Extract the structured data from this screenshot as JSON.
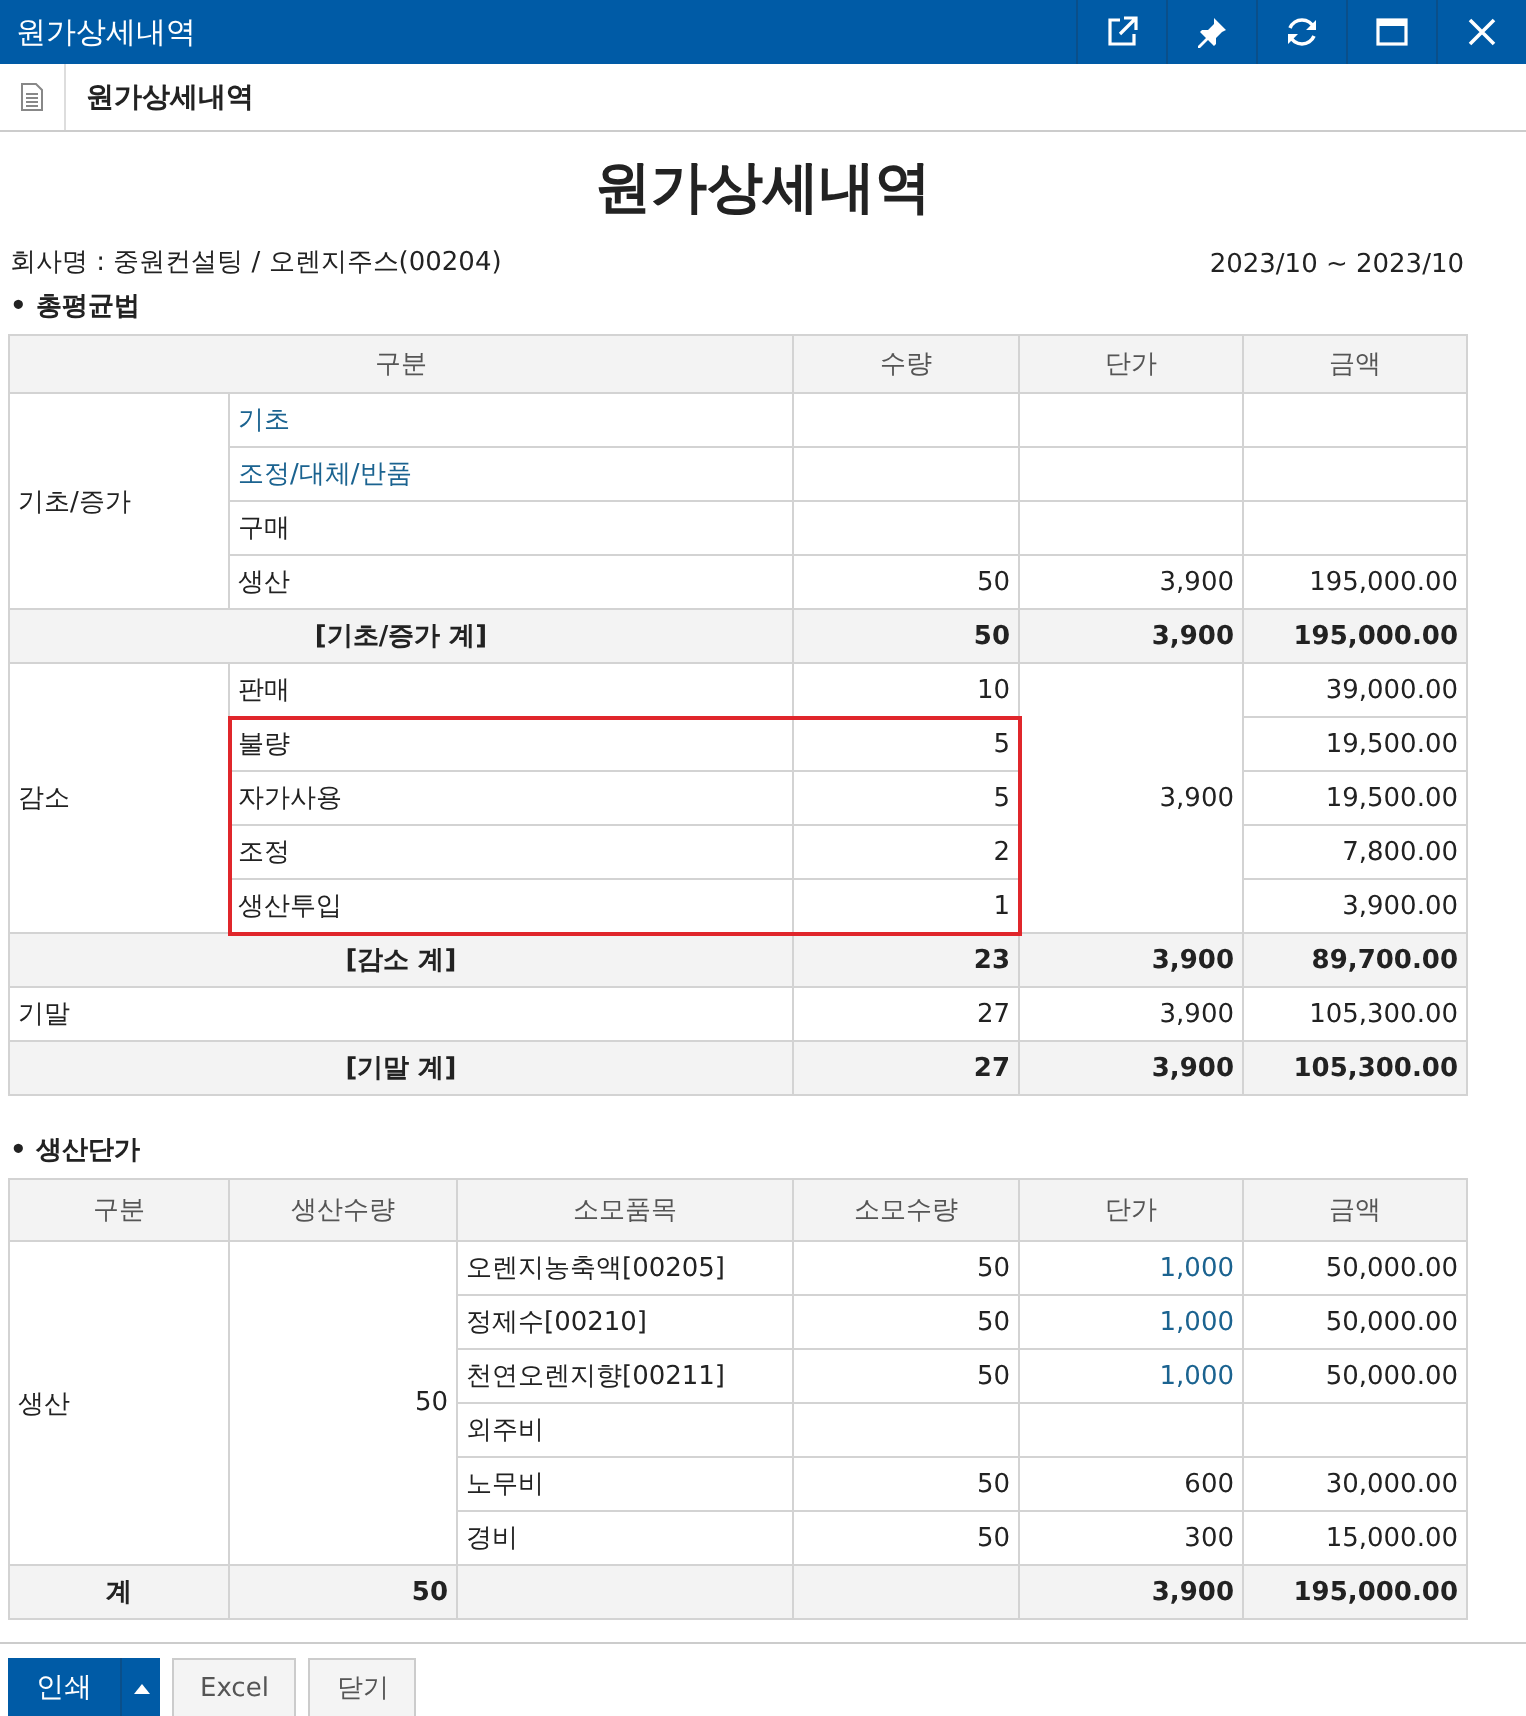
{
  "window": {
    "title": "원가상세내역"
  },
  "tab": {
    "title": "원가상세내역"
  },
  "report": {
    "title": "원가상세내역",
    "company": "회사명 : 중원컨설팅 / 오렌지주스(00204)",
    "period": "2023/10 ~ 2023/10"
  },
  "average_method": {
    "title": "• 총평균법",
    "columns": [
      "구분",
      "수량",
      "단가",
      "금액"
    ],
    "groups": [
      {
        "kind": "nested",
        "label": "기초/증가",
        "rows": [
          {
            "label": "기초",
            "link": true,
            "highlighted": false
          },
          {
            "label": "조정/대체/반품",
            "link": true,
            "highlighted": false
          },
          {
            "label": "구매",
            "link": false,
            "highlighted": false
          },
          {
            "label": "생산",
            "link": false,
            "highlighted": false,
            "qty": "50",
            "price": "3,900",
            "amount": "195,000.00"
          }
        ],
        "subtotal": {
          "label": "[기초/증가 계]",
          "qty": "50",
          "price": "3,900",
          "amount": "195,000.00"
        }
      },
      {
        "kind": "nested",
        "label": "감소",
        "shared_price": "3,900",
        "rows": [
          {
            "label": "판매",
            "link": false,
            "highlighted": false,
            "qty": "10",
            "amount": "39,000.00"
          },
          {
            "label": "불량",
            "link": false,
            "highlighted": true,
            "qty": "5",
            "amount": "19,500.00"
          },
          {
            "label": "자가사용",
            "link": false,
            "highlighted": true,
            "qty": "5",
            "amount": "19,500.00"
          },
          {
            "label": "조정",
            "link": false,
            "highlighted": true,
            "qty": "2",
            "amount": "7,800.00"
          },
          {
            "label": "생산투입",
            "link": false,
            "highlighted": true,
            "qty": "1",
            "amount": "3,900.00"
          }
        ],
        "subtotal": {
          "label": "[감소 계]",
          "qty": "23",
          "price": "3,900",
          "amount": "89,700.00"
        }
      },
      {
        "kind": "flat",
        "label": "기말",
        "qty": "27",
        "price": "3,900",
        "amount": "105,300.00",
        "subtotal": {
          "label": "[기말 계]",
          "qty": "27",
          "price": "3,900",
          "amount": "105,300.00"
        }
      }
    ]
  },
  "production_cost": {
    "title": "• 생산단가",
    "columns": [
      "구분",
      "생산수량",
      "소모품목",
      "소모수량",
      "단가",
      "금액"
    ],
    "group": {
      "label": "생산",
      "qty": "50",
      "items": [
        {
          "name": "오렌지농축액[00205]",
          "qty": "50",
          "price": "1,000",
          "price_link": true,
          "amount": "50,000.00"
        },
        {
          "name": "정제수[00210]",
          "qty": "50",
          "price": "1,000",
          "price_link": true,
          "amount": "50,000.00"
        },
        {
          "name": "천연오렌지향[00211]",
          "qty": "50",
          "price": "1,000",
          "price_link": true,
          "amount": "50,000.00"
        },
        {
          "name": "외주비"
        },
        {
          "name": "노무비",
          "qty": "50",
          "price": "600",
          "price_link": false,
          "amount": "30,000.00"
        },
        {
          "name": "경비",
          "qty": "50",
          "price": "300",
          "price_link": false,
          "amount": "15,000.00"
        }
      ]
    },
    "total": {
      "label": "계",
      "qty": "50",
      "price": "3,900",
      "amount": "195,000.00"
    }
  },
  "buttons": [
    {
      "label": "인쇄",
      "kind": "split"
    },
    {
      "label": "Excel",
      "kind": "plain"
    },
    {
      "label": "닫기",
      "kind": "plain"
    }
  ]
}
